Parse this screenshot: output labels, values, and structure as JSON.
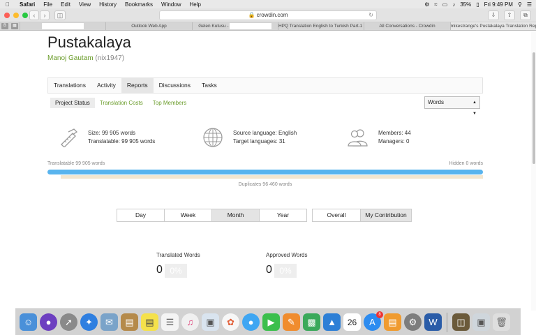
{
  "menubar": {
    "app": "Safari",
    "items": [
      "File",
      "Edit",
      "View",
      "History",
      "Bookmarks",
      "Window",
      "Help"
    ],
    "battery": "35%",
    "clock": "Fri 9:49 PM"
  },
  "browser": {
    "url": "crowdin.com",
    "tabs": [
      {
        "label": ""
      },
      {
        "label": "Outlook Web App"
      },
      {
        "label": "Gelen Kutusu - "
      },
      {
        "label": "HPQ Translation English to Turkish Part-1 (..."
      },
      {
        "label": "All Conversations - Crowdin"
      },
      {
        "label": "mikestrange's Pustakalaya Translation Rep..."
      }
    ]
  },
  "project": {
    "title": "Pustakalaya",
    "owner_name": "Manoj Gautam",
    "owner_handle": "(nix1947)"
  },
  "nav_tabs": [
    "Translations",
    "Activity",
    "Reports",
    "Discussions",
    "Tasks"
  ],
  "sub_tabs": [
    "Project Status",
    "Translation Costs",
    "Top Members"
  ],
  "unit_select": "Words",
  "stats": {
    "size": "Size: 99 905 words",
    "translatable": "Translatable: 99 905 words",
    "source_language": "Source language: English",
    "target_languages": "Target languages: 31",
    "members": "Members: 44",
    "managers": "Managers: 0"
  },
  "progress": {
    "translatable_label": "Translatable 99 905 words",
    "hidden_label": "Hidden 0 words",
    "duplicates_label": "Duplicates 96 460 words",
    "translatable_fraction": 1.0,
    "duplicates_fraction": 0.97
  },
  "periods": [
    "Day",
    "Week",
    "Month",
    "Year"
  ],
  "scopes": [
    "Overall",
    "My Contribution"
  ],
  "metrics": {
    "translated_label": "Translated Words",
    "translated_value": "0",
    "translated_pct": "0%",
    "approved_label": "Approved Words",
    "approved_value": "0",
    "approved_pct": "0%"
  },
  "dock_icons": [
    "finder-icon",
    "siri-icon",
    "launchpad-icon",
    "safari-icon",
    "mail-stamp-icon",
    "notes-icon",
    "stickies-icon",
    "reminders-icon",
    "itunes-icon",
    "preview-icon",
    "photos-icon",
    "messages-icon",
    "facetime-icon",
    "pages-icon",
    "numbers-icon",
    "keynote-icon",
    "calendar-icon",
    "app-store-icon",
    "ibooks-icon",
    "system-preferences-icon",
    "word-icon",
    "photo-viewer-icon",
    "desktop-folder-icon",
    "trash-icon"
  ],
  "dock_calendar_day": "26",
  "dock_badge": "8",
  "colors": {
    "accent_green": "#6a9c2a",
    "progress_blue": "#59b4ee",
    "duplicates_beige": "#f3e6cf"
  }
}
